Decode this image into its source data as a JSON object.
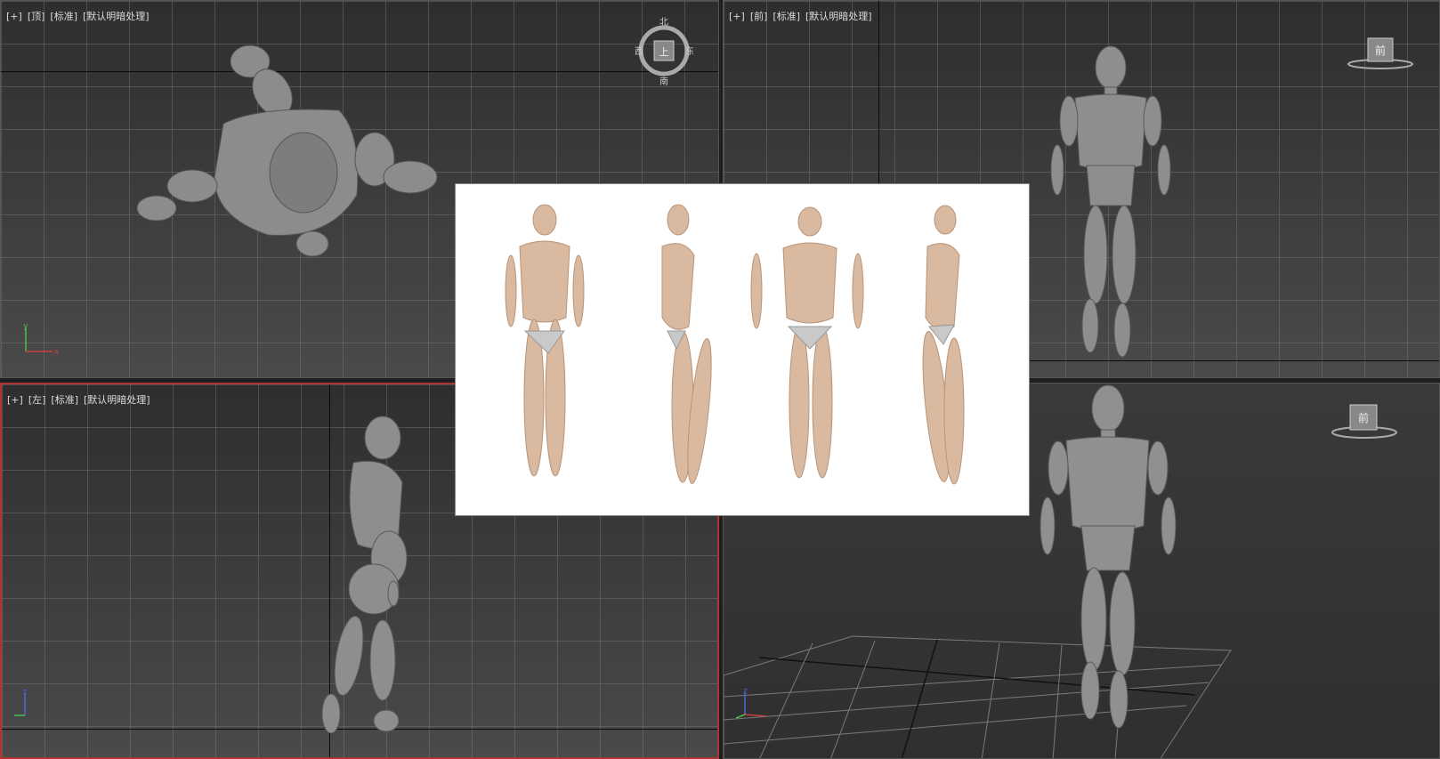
{
  "viewports": {
    "top": {
      "plus": "[+]",
      "view": "[顶]",
      "shading": "[标准]",
      "lighting": "[默认明暗处理]"
    },
    "front": {
      "plus": "[+]",
      "view": "[前]",
      "shading": "[标准]",
      "lighting": "[默认明暗处理]"
    },
    "left": {
      "plus": "[+]",
      "view": "[左]",
      "shading": "[标准]",
      "lighting": "[默认明暗处理]"
    },
    "persp": {
      "plus": "",
      "view": "",
      "shading": "",
      "lighting": ""
    }
  },
  "viewcube_top": {
    "center": "上",
    "north": "北",
    "south": "南",
    "east": "东",
    "west": "西"
  },
  "viewcube_front": {
    "face": "前"
  },
  "viewcube_persp": {
    "face": "前"
  },
  "axes": {
    "x": "x",
    "y": "y",
    "z": "z"
  },
  "colors": {
    "active_border": "#b03434",
    "viewport_bg": "#3b3b3b",
    "model": "#8a8a8a"
  }
}
